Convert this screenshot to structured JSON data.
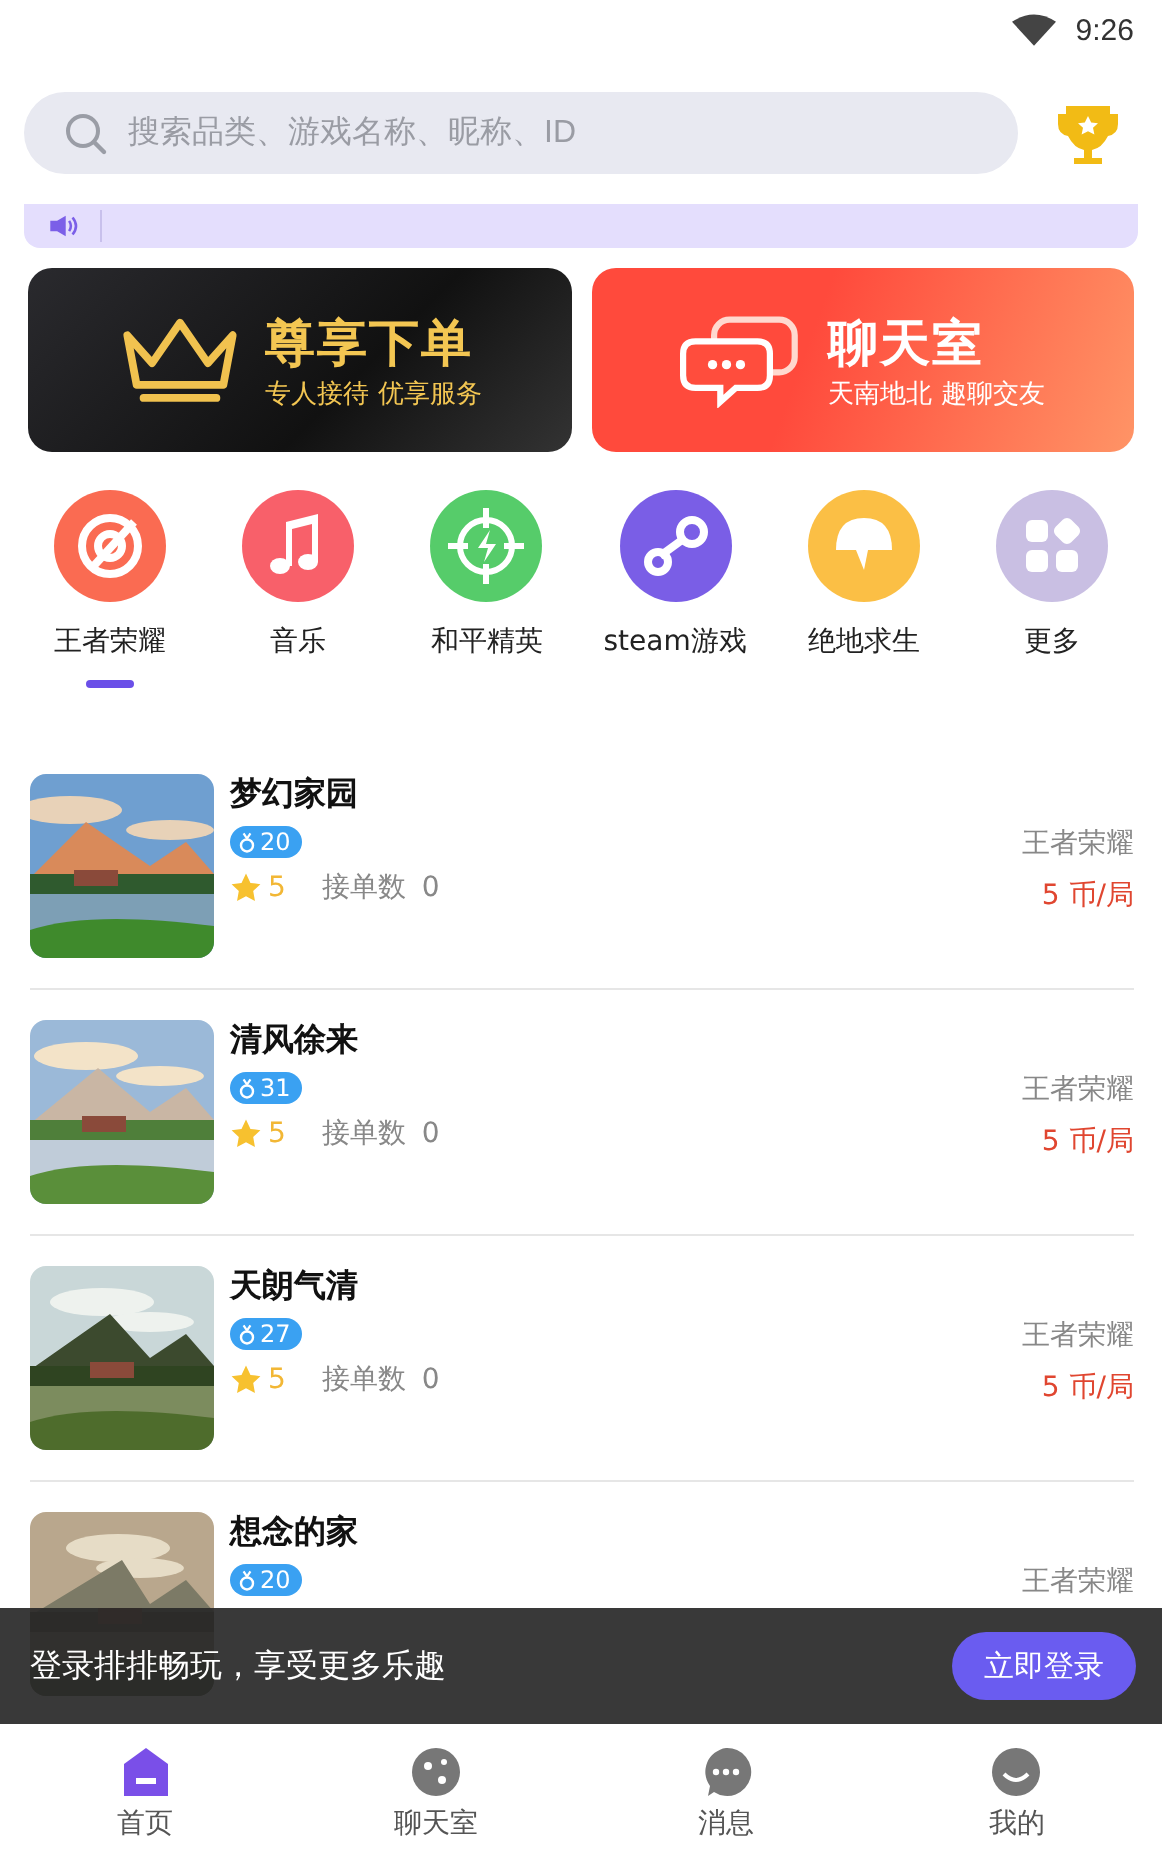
{
  "status_bar": {
    "time": "9:26"
  },
  "search": {
    "placeholder": "搜索品类、游戏名称、昵称、ID"
  },
  "banners": [
    {
      "kind": "vip",
      "title": "尊享下单",
      "subtitle": "专人接待 优享服务"
    },
    {
      "kind": "chat",
      "title": "聊天室",
      "subtitle": "天南地北 趣聊交友"
    }
  ],
  "categories": [
    {
      "label": "王者荣耀",
      "kind": "target",
      "color": "#fa6b52",
      "selected": true
    },
    {
      "label": "音乐",
      "kind": "music",
      "color": "#f8606a",
      "selected": false
    },
    {
      "label": "和平精英",
      "kind": "crosshair",
      "color": "#56cc6a",
      "selected": false
    },
    {
      "label": "steam游戏",
      "kind": "steam",
      "color": "#7a5ee6",
      "selected": false
    },
    {
      "label": "绝地求生",
      "kind": "helmet",
      "color": "#fbbf45",
      "selected": false
    },
    {
      "label": "更多",
      "kind": "more",
      "color": "#c9bfe3",
      "selected": false
    }
  ],
  "players": [
    {
      "name": "梦幻家园",
      "level": "20",
      "rating": "5",
      "orders_label": "接单数",
      "orders": "0",
      "game": "王者荣耀",
      "price": "5 币/局"
    },
    {
      "name": "清风徐来",
      "level": "31",
      "rating": "5",
      "orders_label": "接单数",
      "orders": "0",
      "game": "王者荣耀",
      "price": "5 币/局"
    },
    {
      "name": "天朗气清",
      "level": "27",
      "rating": "5",
      "orders_label": "接单数",
      "orders": "0",
      "game": "王者荣耀",
      "price": "5 币/局"
    },
    {
      "name": "想念的家",
      "level": "20",
      "game": "王者荣耀"
    }
  ],
  "login_prompt": {
    "text": "登录排排畅玩，享受更多乐趣",
    "button": "立即登录"
  },
  "nav": [
    {
      "label": "首页",
      "kind": "home",
      "selected": true
    },
    {
      "label": "聊天室",
      "kind": "chat",
      "selected": false
    },
    {
      "label": "消息",
      "kind": "message",
      "selected": false
    },
    {
      "label": "我的",
      "kind": "profile",
      "selected": false
    }
  ]
}
